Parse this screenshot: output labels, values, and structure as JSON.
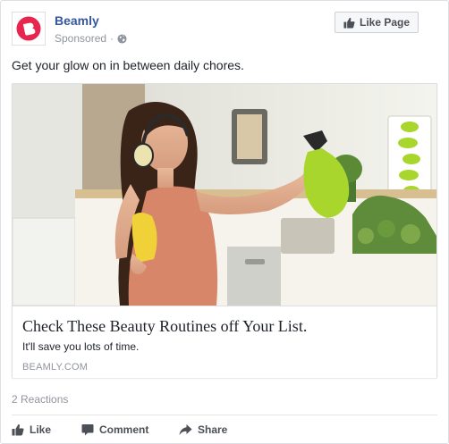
{
  "post": {
    "page_name": "Beamly",
    "sponsored_label": "Sponsored",
    "separator": "·",
    "text": "Get your glow on in between daily chores."
  },
  "like_page_button": {
    "label": "Like Page"
  },
  "ad": {
    "headline": "Check These Beauty Routines off Your List.",
    "description": "It'll save you lots of time.",
    "domain": "BEAMLY.COM"
  },
  "reactions": {
    "summary": "2 Reactions"
  },
  "actions": [
    {
      "label": "Like",
      "icon": "thumbs-up-icon"
    },
    {
      "label": "Comment",
      "icon": "comment-icon"
    },
    {
      "label": "Share",
      "icon": "share-icon"
    }
  ],
  "colors": {
    "brand_red": "#e8254f",
    "link_blue": "#365899",
    "spray_green": "#a8d62c"
  }
}
